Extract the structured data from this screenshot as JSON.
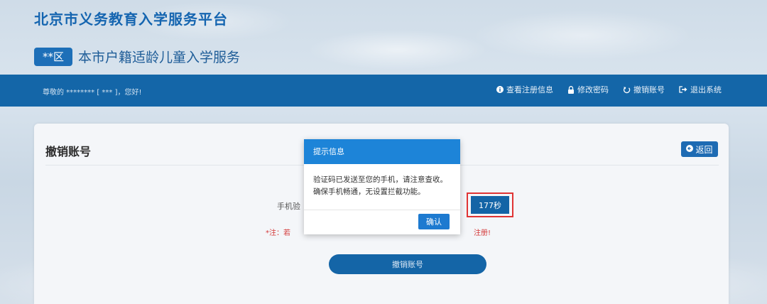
{
  "header": {
    "platform_title": "北京市义务教育入学服务平台",
    "district_badge": "**区",
    "service_title": "本市户籍适龄儿童入学服务"
  },
  "navbar": {
    "greeting": "尊敬的 ******** [ *** ]，您好!",
    "links": [
      {
        "label": "查看注册信息",
        "icon": "info-icon"
      },
      {
        "label": "修改密码",
        "icon": "lock-icon"
      },
      {
        "label": "撤销账号",
        "icon": "undo-icon"
      },
      {
        "label": "退出系统",
        "icon": "logout-icon"
      }
    ]
  },
  "panel": {
    "title": "撤销账号",
    "back_label": "返回",
    "phone_label": "手机验",
    "countdown_label": "177秒",
    "note_left": "*注：若",
    "note_right": "注册!",
    "cancel_button_label": "撤销账号"
  },
  "dialog": {
    "title": "提示信息",
    "message_line1": "验证码已发送至您的手机，请注意查收。",
    "message_line2": "确保手机畅通，无设置拦截功能。",
    "confirm_label": "确认"
  },
  "colors": {
    "navbar": "#1466a8",
    "primary": "#1d7ad0",
    "highlight_border": "#e03434",
    "note": "#d43a3a"
  }
}
